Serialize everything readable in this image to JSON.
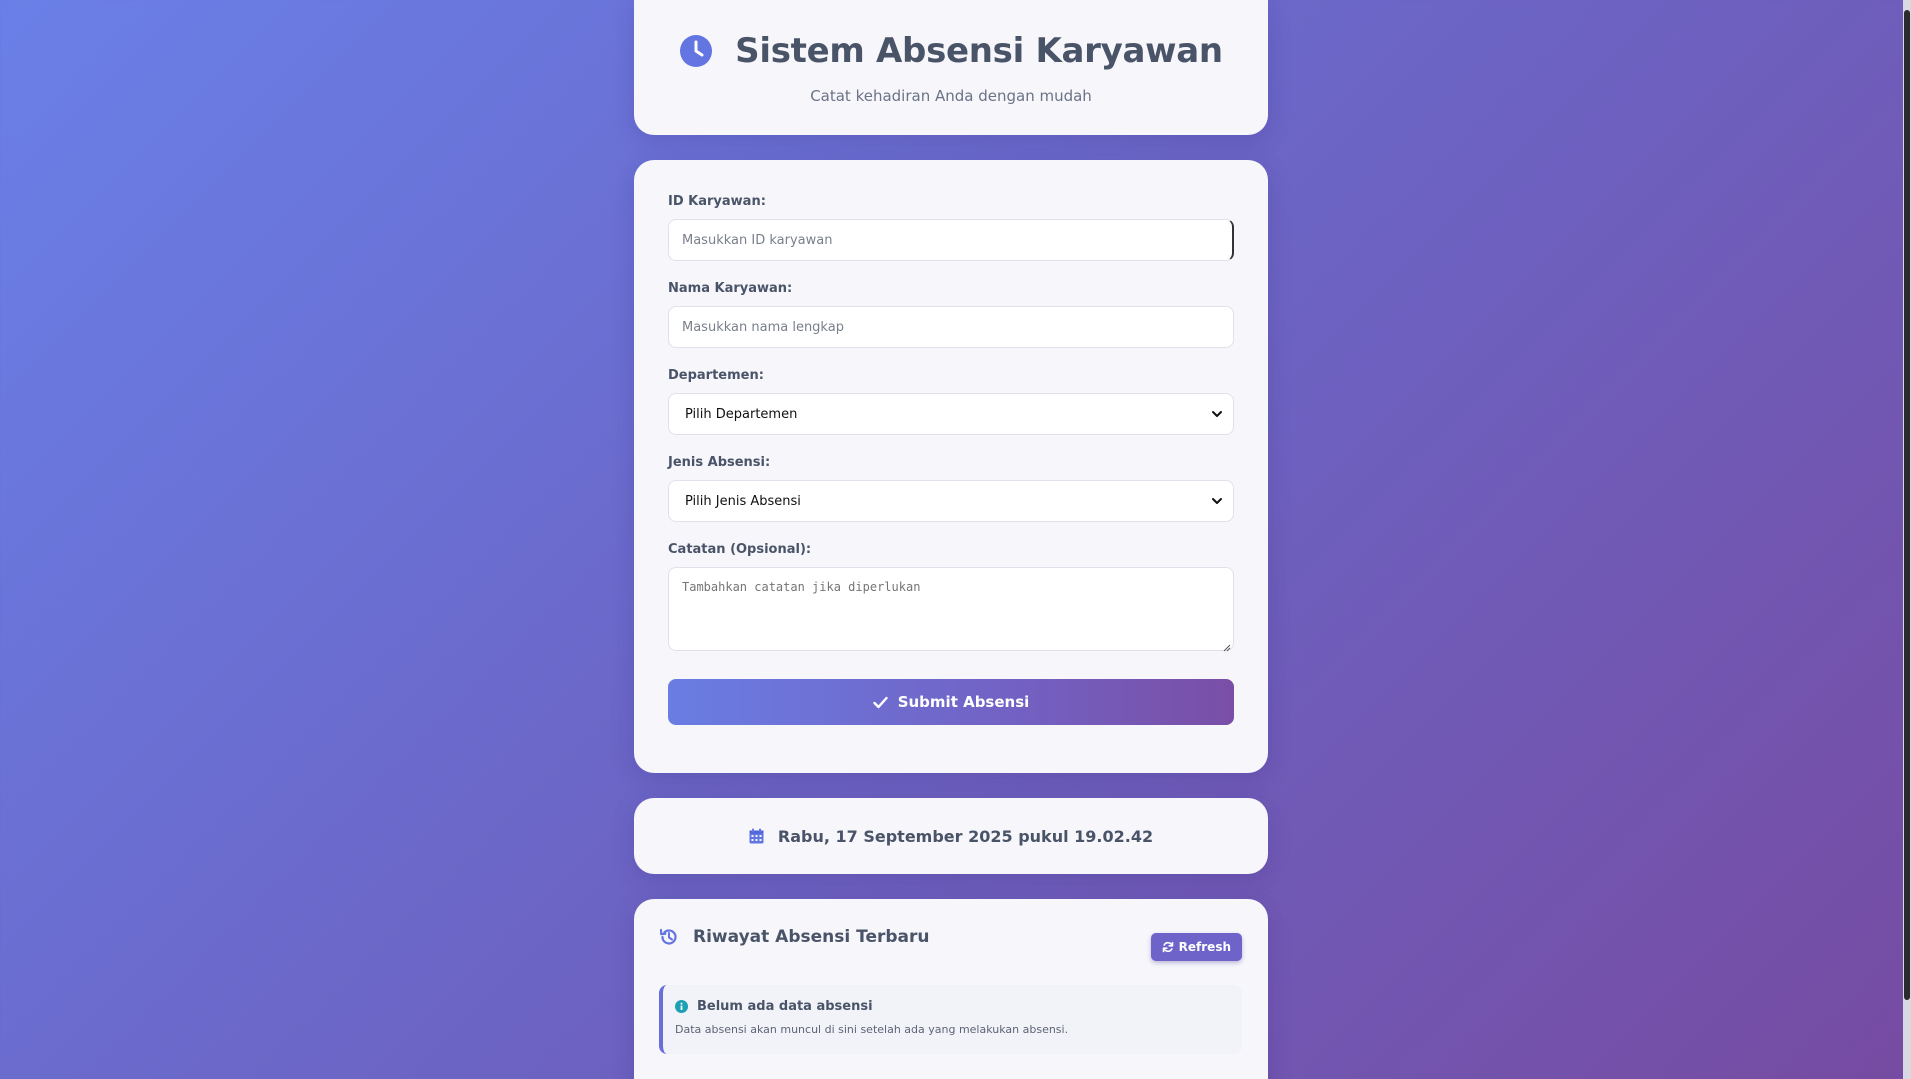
{
  "header": {
    "title": "Sistem Absensi Karyawan",
    "subtitle": "Catat kehadiran Anda dengan mudah",
    "icon": "clock-icon"
  },
  "form": {
    "id_label": "ID Karyawan:",
    "id_placeholder": "Masukkan ID karyawan",
    "id_value": "",
    "name_label": "Nama Karyawan:",
    "name_placeholder": "Masukkan nama lengkap",
    "name_value": "",
    "dept_label": "Departemen:",
    "dept_selected": "Pilih Departemen",
    "type_label": "Jenis Absensi:",
    "type_selected": "Pilih Jenis Absensi",
    "notes_label": "Catatan (Opsional):",
    "notes_placeholder": "Tambahkan catatan jika diperlukan",
    "notes_value": "",
    "submit_label": "Submit Absensi"
  },
  "datetime": {
    "text": "Rabu, 17 September 2025 pukul 19.02.42",
    "icon": "calendar-icon"
  },
  "history": {
    "title": "Riwayat Absensi Terbaru",
    "refresh_label": "Refresh",
    "empty_title": "Belum ada data absensi",
    "empty_text": "Data absensi akan muncul di sini setelah ada yang melakukan absensi."
  },
  "colors": {
    "accent": "#667eea",
    "accent_dark": "#764ba2",
    "text": "#4a5468"
  }
}
